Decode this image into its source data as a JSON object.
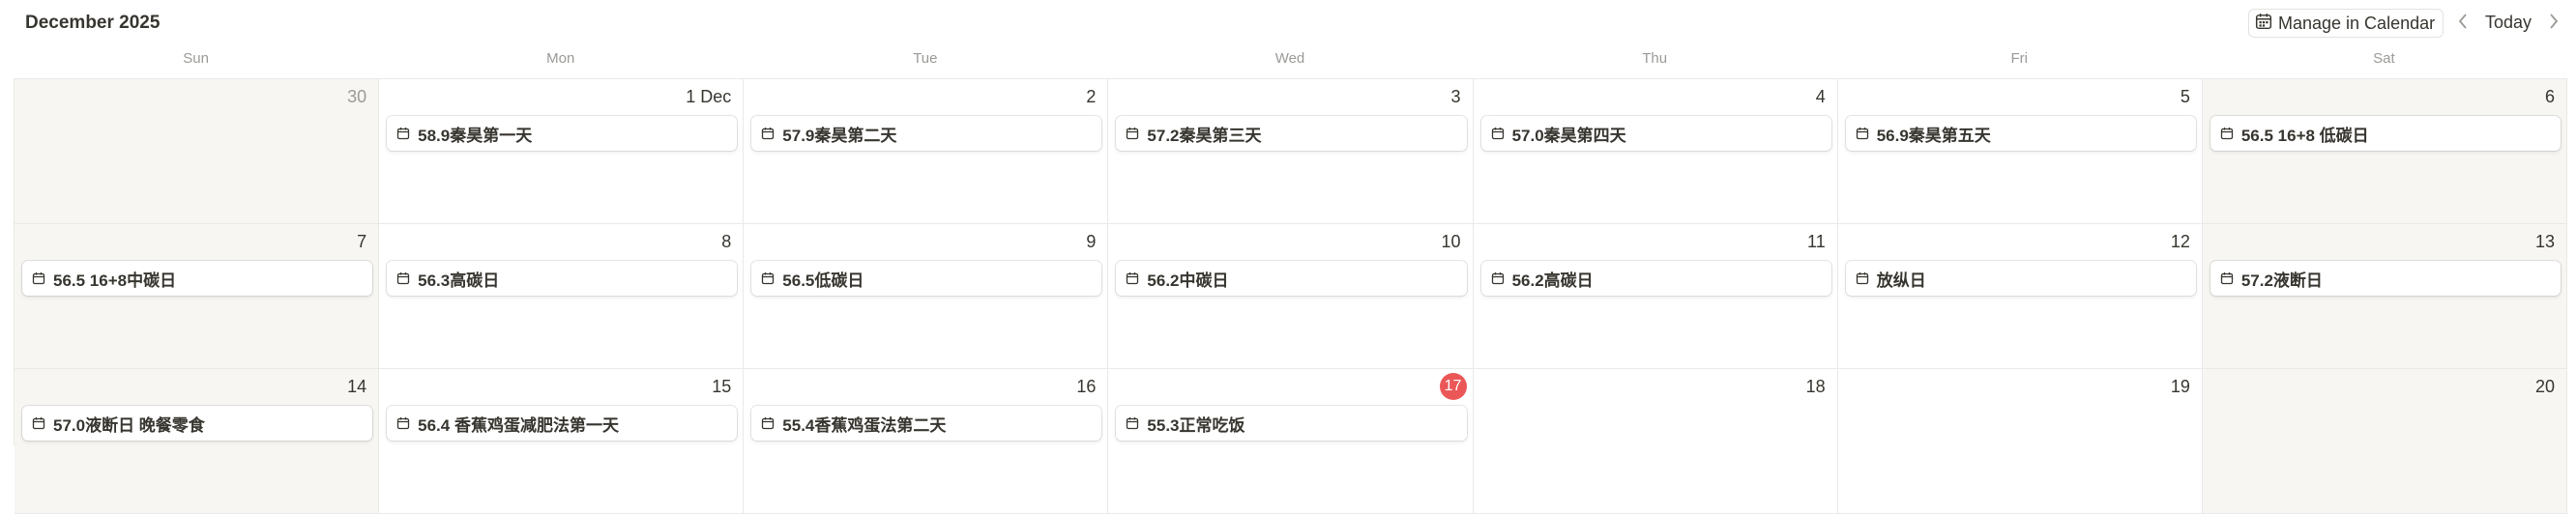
{
  "header": {
    "month_title": "December 2025",
    "manage_label": "Manage in Calendar",
    "today_label": "Today"
  },
  "weekdays": [
    "Sun",
    "Mon",
    "Tue",
    "Wed",
    "Thu",
    "Fri",
    "Sat"
  ],
  "colors": {
    "today_badge": "#eb5757",
    "weekend_bg": "#f7f6f3"
  },
  "weeks": [
    [
      {
        "day": "30",
        "event": ""
      },
      {
        "day": "1 Dec",
        "event": "58.9秦昊第一天"
      },
      {
        "day": "2",
        "event": "57.9秦昊第二天"
      },
      {
        "day": "3",
        "event": "57.2秦昊第三天"
      },
      {
        "day": "4",
        "event": "57.0秦昊第四天"
      },
      {
        "day": "5",
        "event": "56.9秦昊第五天"
      },
      {
        "day": "6",
        "event": "56.5 16+8 低碳日"
      }
    ],
    [
      {
        "day": "7",
        "event": "56.5 16+8中碳日"
      },
      {
        "day": "8",
        "event": "56.3高碳日"
      },
      {
        "day": "9",
        "event": "56.5低碳日"
      },
      {
        "day": "10",
        "event": "56.2中碳日"
      },
      {
        "day": "11",
        "event": "56.2高碳日"
      },
      {
        "day": "12",
        "event": "放纵日"
      },
      {
        "day": "13",
        "event": "57.2液断日"
      }
    ],
    [
      {
        "day": "14",
        "event": "57.0液断日 晚餐零食"
      },
      {
        "day": "15",
        "event": "56.4 香蕉鸡蛋减肥法第一天"
      },
      {
        "day": "16",
        "event": "55.4香蕉鸡蛋法第二天"
      },
      {
        "day": "17",
        "event": "55.3正常吃饭"
      },
      {
        "day": "18",
        "event": ""
      },
      {
        "day": "19",
        "event": ""
      },
      {
        "day": "20",
        "event": ""
      }
    ]
  ]
}
